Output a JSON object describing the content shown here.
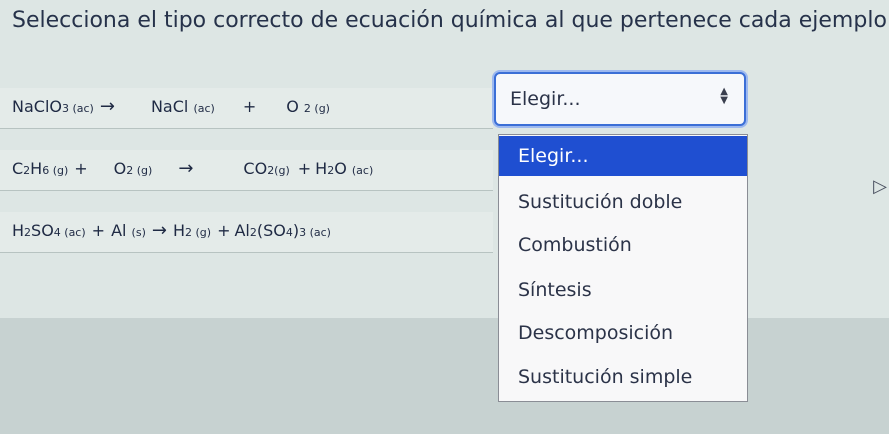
{
  "question": "Selecciona el tipo correcto de ecuación química al que pertenece cada ejemplo",
  "equations": [
    {
      "p1": "NaClO",
      "p1sub": "3 (ac)",
      "p2": "NaCl",
      "p2sub": "(ac)",
      "plus": "+",
      "p3": "O",
      "p3sub": "2 (g)"
    },
    {
      "p1": "C",
      "p1sub": "2",
      "p1b": "H",
      "p1bsub": "6 (g)",
      "plus1": "+",
      "p2": "O",
      "p2sub": "2 (g)",
      "p3": "CO",
      "p3sub": "2(g)",
      "plus2": "+",
      "p4": "H",
      "p4sub": "2",
      "p4b": "O",
      "p4bsub": "(ac)"
    },
    {
      "p1": "H",
      "p1sub": "2",
      "p1b": "SO",
      "p1bsub": "4 (ac)",
      "plus1": "+",
      "p2": "Al",
      "p2sub": "(s)",
      "p3": "H",
      "p3sub": "2 (g)",
      "plus2": "+",
      "p4": "Al",
      "p4sub": "2",
      "p4b": "(SO",
      "p4bsub": "4",
      "p4c": ")",
      "p4csub": "3 (ac)"
    }
  ],
  "arrow": "→",
  "select": {
    "value": "Elegir...",
    "arrows_up": "▲",
    "arrows_down": "▼"
  },
  "dropdown_options": [
    "Elegir...",
    "Sustitución doble",
    "Combustión",
    "Síntesis",
    "Descomposición",
    "Sustitución simple"
  ],
  "selected_option_index": 0,
  "edge_mark": "▷"
}
